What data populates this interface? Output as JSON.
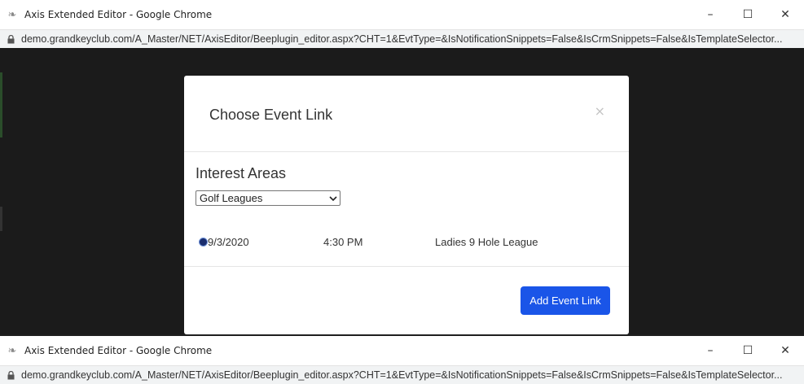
{
  "window_top": {
    "title": "Axis Extended Editor - Google Chrome",
    "app_icon": "feather-icon",
    "controls": {
      "minimize": "–",
      "maximize": "☐",
      "close": "✕"
    },
    "url": "demo.grandkeyclub.com/A_Master/NET/AxisEditor/Beeplugin_editor.aspx?CHT=1&EvtType=&IsNotificationSnippets=False&IsCrmSnippets=False&IsTemplateSelector..."
  },
  "modal": {
    "title": "Choose Event Link",
    "close_label": "×",
    "section_label": "Interest Areas",
    "select_value": "Golf Leagues",
    "event": {
      "date": "9/3/2020",
      "time": "4:30 PM",
      "name": "Ladies 9 Hole League"
    },
    "button_label": "Add Event Link",
    "accent_color": "#1a55e8"
  },
  "window_bottom": {
    "title": "Axis Extended Editor - Google Chrome",
    "controls": {
      "minimize": "–",
      "maximize": "☐",
      "close": "✕"
    },
    "url": "demo.grandkeyclub.com/A_Master/NET/AxisEditor/Beeplugin_editor.aspx?CHT=1&EvtType=&IsNotificationSnippets=False&IsCrmSnippets=False&IsTemplateSelector..."
  }
}
